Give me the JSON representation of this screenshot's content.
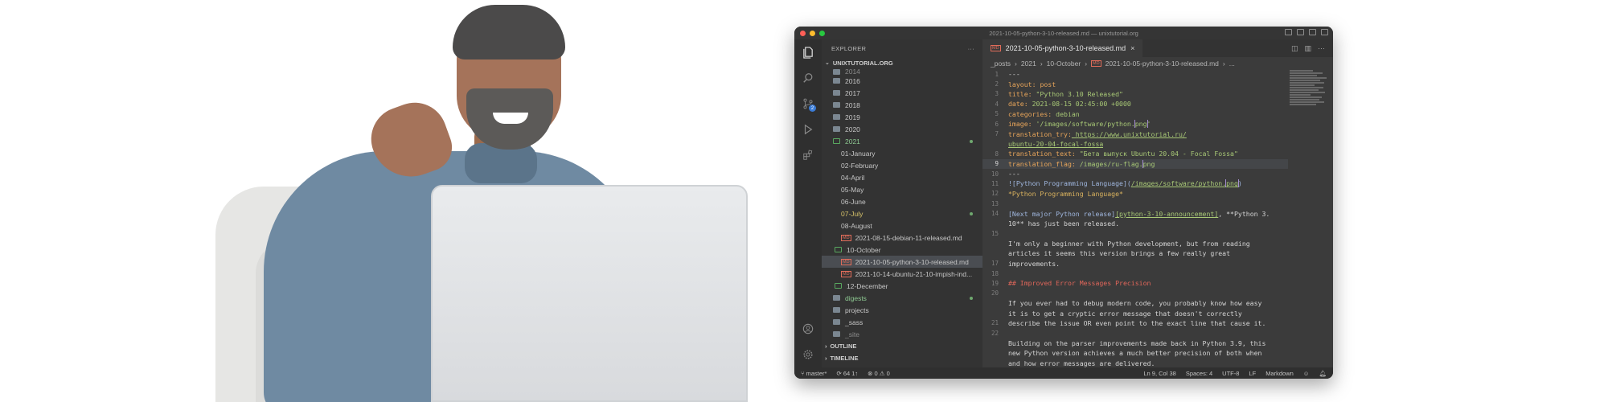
{
  "window": {
    "title": "2021-10-05-python-3-10-released.md — unixtutorial.org"
  },
  "colors": {
    "close": "#ff5f57",
    "minimize": "#febc2e",
    "maximize": "#28c840",
    "accent": "#3a7bd5"
  },
  "activity_bar": {
    "icons": [
      "files-icon",
      "search-icon",
      "source-control-icon",
      "run-debug-icon",
      "extensions-icon",
      "account-icon",
      "settings-gear-icon"
    ],
    "scm_badge": "2"
  },
  "explorer": {
    "header": "EXPLORER",
    "more": "···",
    "root": "UNIXTUTORIAL.ORG",
    "items": [
      {
        "label": "2014"
      },
      {
        "label": "2016"
      },
      {
        "label": "2017"
      },
      {
        "label": "2018"
      },
      {
        "label": "2019"
      },
      {
        "label": "2020"
      },
      {
        "label": "2021"
      },
      {
        "label": "01-January"
      },
      {
        "label": "02-February"
      },
      {
        "label": "04-April"
      },
      {
        "label": "05-May"
      },
      {
        "label": "06-June"
      },
      {
        "label": "07-July"
      },
      {
        "label": "08-August"
      },
      {
        "label": "2021-08-15-debian-11-released.md"
      },
      {
        "label": "10-October"
      },
      {
        "label": "2021-10-05-python-3-10-released.md"
      },
      {
        "label": "2021-10-14-ubuntu-21-10-impish-ind..."
      },
      {
        "label": "12-December"
      },
      {
        "label": "digests"
      },
      {
        "label": "projects"
      },
      {
        "label": "_sass"
      },
      {
        "label": "_site"
      }
    ],
    "outline": "OUTLINE",
    "timeline": "TIMELINE"
  },
  "tab": {
    "label": "2021-10-05-python-3-10-released.md",
    "badge": "MD",
    "close": "×"
  },
  "breadcrumb": {
    "parts": [
      "_posts",
      "2021",
      "10-October",
      "2021-10-05-python-3-10-released.md",
      "..."
    ],
    "sep": "›"
  },
  "code": {
    "line_numbers": [
      "1",
      "2",
      "3",
      "4",
      "5",
      "6",
      "7",
      "",
      "8",
      "9",
      "10",
      "11",
      "12",
      "13",
      "14",
      "",
      "15",
      "",
      "",
      "17",
      "18",
      "19",
      "20",
      "",
      "",
      "21",
      "22",
      ""
    ],
    "lines": {
      "l1": "---",
      "l2a": "layout:",
      "l2b": " post",
      "l3a": "title:",
      "l3b": "  \"Python 3.10 Released\"",
      "l4a": "date:",
      "l4b": "   2021-08-15 02:45:00 +0000",
      "l5a": "categories:",
      "l5b": " debian",
      "l6a": "image:",
      "l6b": " '/images/software/python.",
      "l6c": "png",
      "l6d": "'",
      "l7a": "translation_try:",
      "l7b": " https://www.unixtutorial.ru/",
      "l7c": "ubuntu-20-04-focal-fossa",
      "l8a": "translation_text:",
      "l8b": " \"Бета выпуск Ubuntu 20.04 - Focal Fossa\"",
      "l9a": "translation_flag:",
      "l9b": " /images/ru-flag.",
      "l9c": "png",
      "l10": "---",
      "l11a": "![Python Programming Language](",
      "l11b": "/images/software/python.",
      "l11c": "png",
      "l11d": ")",
      "l12": "*Python Programming Language*",
      "l14a": "[Next major Python release]",
      "l14b": "[python-3-10-announcement]",
      "l14c": ", **Python 3.",
      "l14d": "10** has just been released.",
      "l15a": "I'm only a beginner with Python development, but from reading",
      "l15b": "articles it seems this version brings a few really great",
      "l15c": "improvements.",
      "l18": "## Improved Error Messages Precision",
      "l20a": "If you ever had to debug modern code, you probably know how easy",
      "l20b": "it is to get a cryptic error message that doesn't correctly",
      "l20c": "describe the issue OR even point to the exact line that cause it.",
      "l22a": "Building on the parser improvements made back in Python 3.9, this",
      "l22b": "new Python version achieves a much better precision of both when",
      "l22c": "and how error messages are delivered."
    }
  },
  "status": {
    "branch": "master*",
    "sync": "64 1↑",
    "problems": "⊗ 0 ⚠ 0",
    "position": "Ln 9, Col 38",
    "spaces": "Spaces: 4",
    "encoding": "UTF-8",
    "eol": "LF",
    "language": "Markdown"
  }
}
